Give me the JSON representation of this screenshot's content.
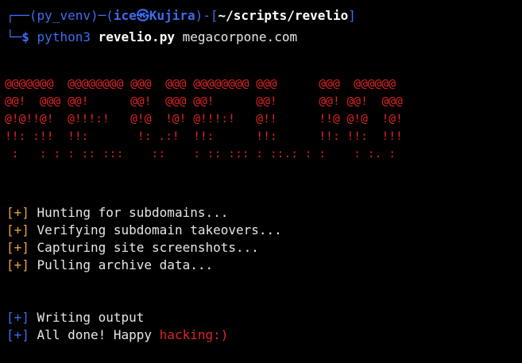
{
  "prompt": {
    "corner_top": "┌──",
    "env": "(py_venv)",
    "dash": "─",
    "user_open": "(",
    "user": "ice",
    "at_symbol": "㉿",
    "host": "Kujira",
    "user_close": ")",
    "dash2": "-",
    "dir_open": "[",
    "directory": "~/scripts/revelio",
    "dir_close": "]",
    "corner_bottom": "└─",
    "dollar": "$",
    "command": "python3",
    "script": "revelio.py",
    "argument": "megacorpone.com"
  },
  "banner": [
    "@@@@@@@  @@@@@@@@ @@@  @@@ @@@@@@@@ @@@      @@@  @@@@@@",
    "@@!  @@@ @@!      @@!  @@@ @@!      @@!      @@! @@!  @@@",
    "@!@!!@!  @!!!:!   @!@  !@! @!!!:!   @!!      !!@ @!@  !@!",
    "!!: :!!  !!:       !: .:!  !!:      !!:      !!: !!:  !!!",
    " :   : : : :: :::    ::    : :: ::: : ::.: : :    : :. :"
  ],
  "steps": [
    {
      "bracket": "[+]",
      "text": "Hunting for subdomains..."
    },
    {
      "bracket": "[+]",
      "text": "Verifying subdomain takeovers..."
    },
    {
      "bracket": "[+]",
      "text": "Capturing site screenshots..."
    },
    {
      "bracket": "[+]",
      "text": "Pulling archive data..."
    }
  ],
  "final": [
    {
      "bracket": "[+]",
      "text": "Writing output"
    },
    {
      "bracket": "[+]",
      "text": "All done! Happy ",
      "highlight": "hacking:)"
    }
  ],
  "colors": {
    "background": "#000000",
    "prompt_blue": "#3d6cf0",
    "banner_red": "#e02424",
    "step_orange": "#e8a33a",
    "text": "#e6e6e6"
  }
}
